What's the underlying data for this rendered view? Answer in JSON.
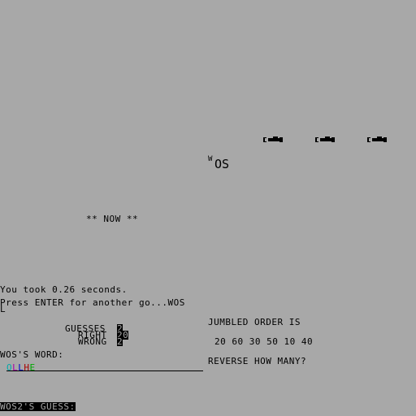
{
  "top_sprite": {
    "small": "W",
    "big": "OS"
  },
  "now_label": "** NOW **",
  "timing_line": "You took 0.26 seconds.",
  "prompt_line1": "Press ENTER for another go...WOS",
  "prompt_line2": "L",
  "stats": {
    "guesses_label": "GUESSES",
    "guesses_value": "2",
    "right_label": "RIGHT",
    "right_value": "20",
    "wrong_label": "WRONG",
    "wrong_value": "2"
  },
  "jumbled": {
    "label": "JUMBLED ORDER IS",
    "values": "20 60 30 50 10 40",
    "reverse_prompt": "REVERSE HOW MANY?"
  },
  "word": {
    "label": "WOS'S WORD:",
    "letters": [
      {
        "char": "O",
        "color": "#00a8a8"
      },
      {
        "char": "L",
        "color": "#a800a8"
      },
      {
        "char": "L",
        "color": "#0000c8"
      },
      {
        "char": "H",
        "color": "#a80000"
      },
      {
        "char": "E",
        "color": "#00a800"
      }
    ]
  },
  "guess_label": "WOS2'S GUESS:",
  "icons": {
    "plane": "plane-icon"
  }
}
